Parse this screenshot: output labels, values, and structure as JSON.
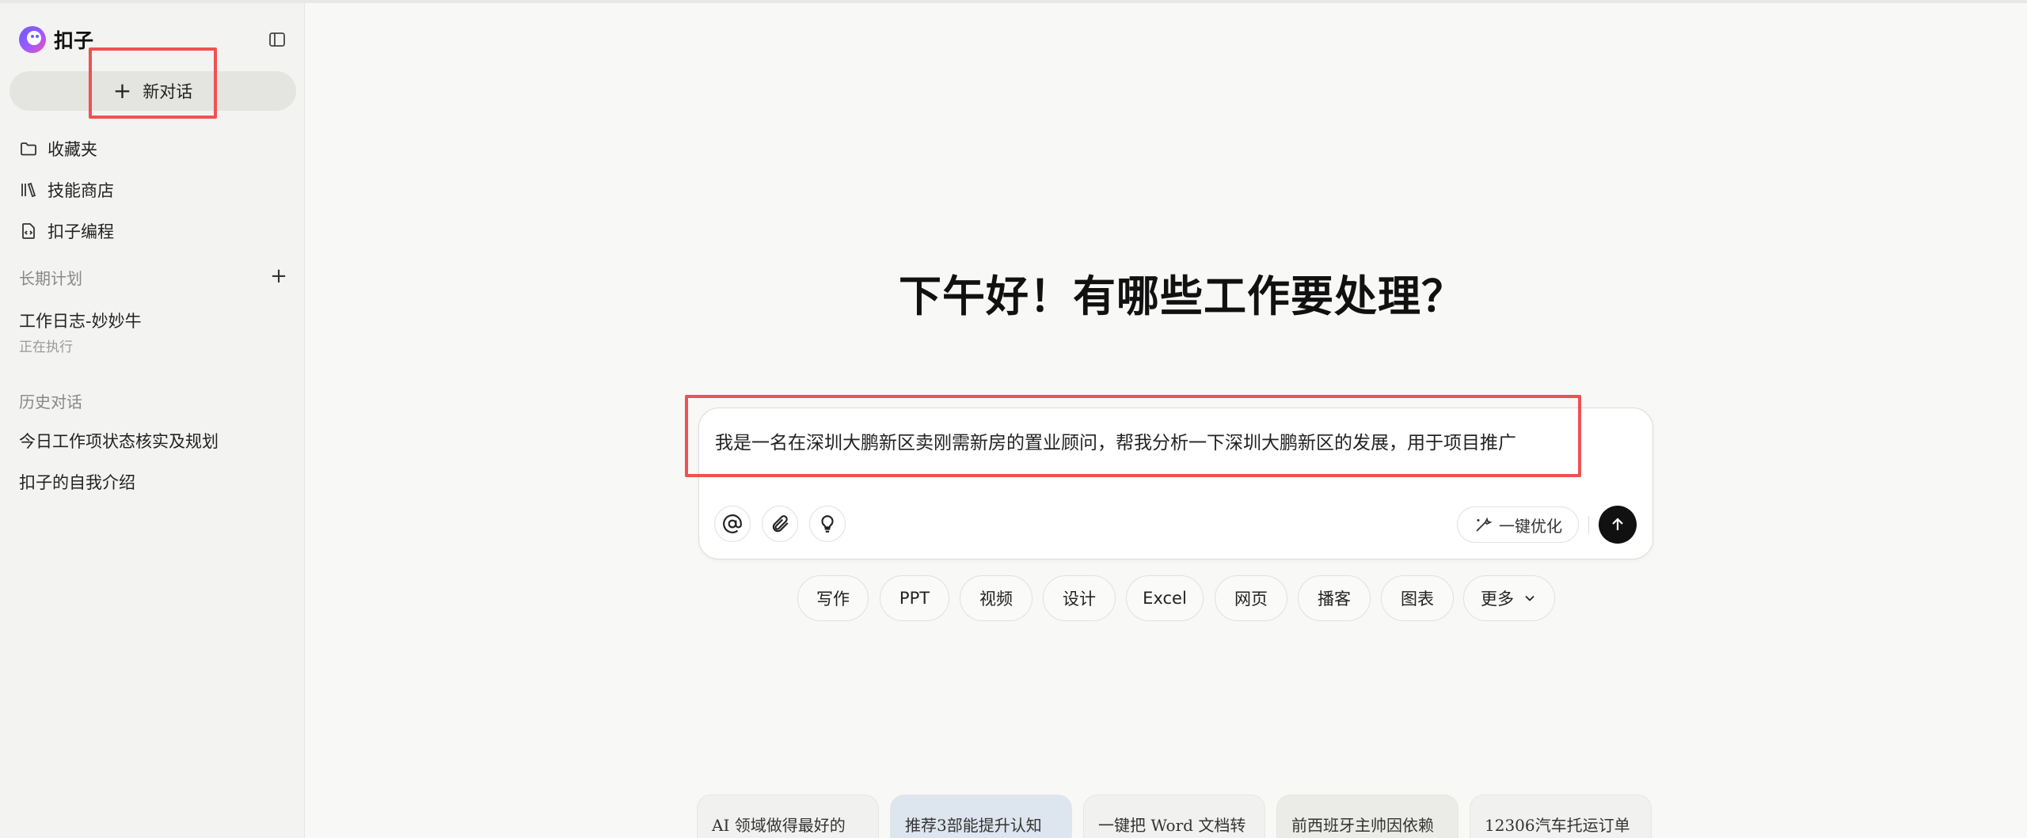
{
  "app": {
    "name": "扣子"
  },
  "sidebar": {
    "new_chat_label": "新对话",
    "nav_items": [
      {
        "label": "收藏夹",
        "icon": "folder-icon"
      },
      {
        "label": "技能商店",
        "icon": "library-icon"
      },
      {
        "label": "扣子编程",
        "icon": "code-file-icon"
      }
    ],
    "plans_title": "长期计划",
    "plans": [
      {
        "title": "工作日志-妙妙牛",
        "status": "正在执行"
      }
    ],
    "history_title": "历史对话",
    "history": [
      "今日工作项状态核实及规划",
      "扣子的自我介绍"
    ]
  },
  "main": {
    "greeting": "下午好！有哪些工作要处理？",
    "input_value": "我是一名在深圳大鹏新区卖刚需新房的置业顾问，帮我分析一下深圳大鹏新区的发展，用于项目推广",
    "optimize_label": "一键优化",
    "chips": [
      "写作",
      "PPT",
      "视频",
      "设计",
      "Excel",
      "网页",
      "播客",
      "图表",
      "更多"
    ],
    "cards": [
      "AI 领域做得最好的",
      "推荐3部能提升认知",
      "一键把 Word 文档转",
      "前西班牙主帅因依赖",
      "12306汽车托运订单"
    ]
  },
  "colors": {
    "highlight": "#ee5253",
    "send_button": "#111111",
    "sidebar_bg": "#f3f3f1",
    "new_chat_bg": "#e4e4e0"
  }
}
